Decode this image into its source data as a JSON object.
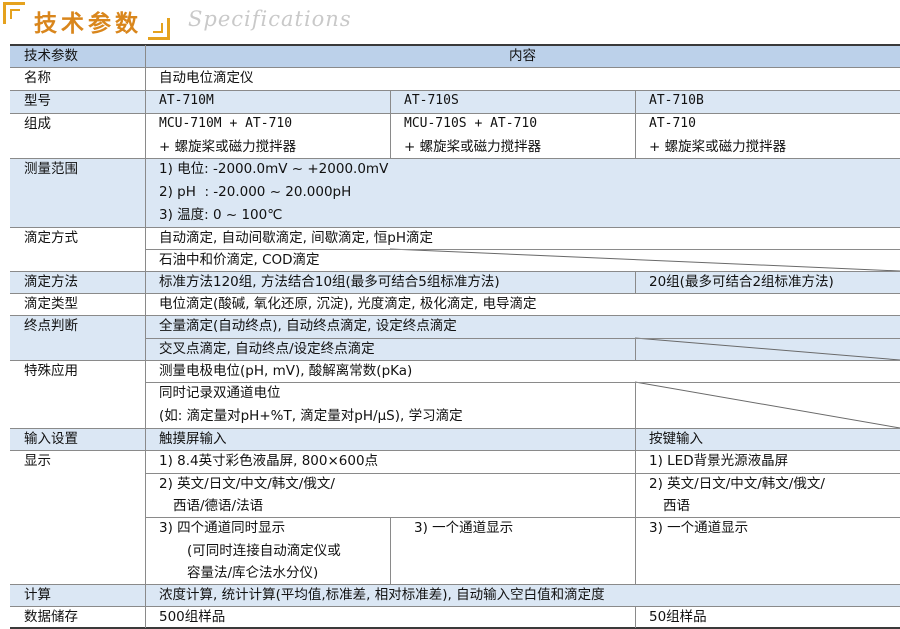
{
  "header": {
    "title": "技术参数",
    "subtitle": "Specifications"
  },
  "table": {
    "col_param": "技术参数",
    "col_content": "内容",
    "name": {
      "label": "名称",
      "value": "自动电位滴定仪"
    },
    "model": {
      "label": "型号",
      "m1": "AT-710M",
      "m2": "AT-710S",
      "m3": "AT-710B"
    },
    "composition": {
      "label": "组成",
      "m1_line1": "MCU-710M + AT-710",
      "m1_line2": "+ 螺旋桨或磁力搅拌器",
      "m2_line1": "MCU-710S + AT-710",
      "m2_line2": "+ 螺旋桨或磁力搅拌器",
      "m3_line1": "AT-710",
      "m3_line2": "+ 螺旋桨或磁力搅拌器"
    },
    "range": {
      "label": "测量范围",
      "line1": "1) 电位: -2000.0mV ~ +2000.0mV",
      "line2": "2) pH  : -20.000 ~ 20.000pH",
      "line3": "3) 温度: 0 ~ 100℃"
    },
    "titration_mode": {
      "label": "滴定方式",
      "line1": "自动滴定, 自动间歇滴定, 间歇滴定, 恒pH滴定",
      "line2": "石油中和价滴定, COD滴定"
    },
    "method": {
      "label": "滴定方法",
      "ms": "标准方法120组, 方法结合10组(最多可结合5组标准方法)",
      "b": "20组(最多可结合2组标准方法)"
    },
    "type": {
      "label": "滴定类型",
      "value": "电位滴定(酸碱, 氧化还原, 沉淀), 光度滴定, 极化滴定, 电导滴定"
    },
    "endpoint": {
      "label": "终点判断",
      "line1": "全量滴定(自动终点), 自动终点滴定, 设定终点滴定",
      "line2": "交叉点滴定, 自动终点/设定终点滴定"
    },
    "special": {
      "label": "特殊应用",
      "line1": "测量电极电位(pH, mV), 酸解离常数(pKa)",
      "line2": "同时记录双通道电位",
      "line3": "(如: 滴定量对pH+%T, 滴定量对pH/μS), 学习滴定"
    },
    "input": {
      "label": "输入设置",
      "ms": "触摸屏输入",
      "b": "按键输入"
    },
    "display": {
      "label": "显示",
      "ms_line1": "1) 8.4英寸彩色液晶屏, 800×600点",
      "ms_line2": "2) 英文/日文/中文/韩文/俄文/",
      "ms_line3": "西语/德语/法语",
      "m_line4": "3) 四个通道同时显示",
      "m_line5": "(可同时连接自动滴定仪或",
      "m_line6": "容量法/库仑法水分仪)",
      "s_line4": "3) 一个通道显示",
      "b_line1": "1) LED背景光源液晶屏",
      "b_line2": "2) 英文/日文/中文/韩文/俄文/",
      "b_line3": "西语",
      "b_line4": "3) 一个通道显示"
    },
    "calc": {
      "label": "计算",
      "value": "浓度计算, 统计计算(平均值,标准差, 相对标准差), 自动输入空白值和滴定度"
    },
    "storage": {
      "label": "数据储存",
      "ms": "500组样品",
      "b": "50组样品"
    }
  }
}
